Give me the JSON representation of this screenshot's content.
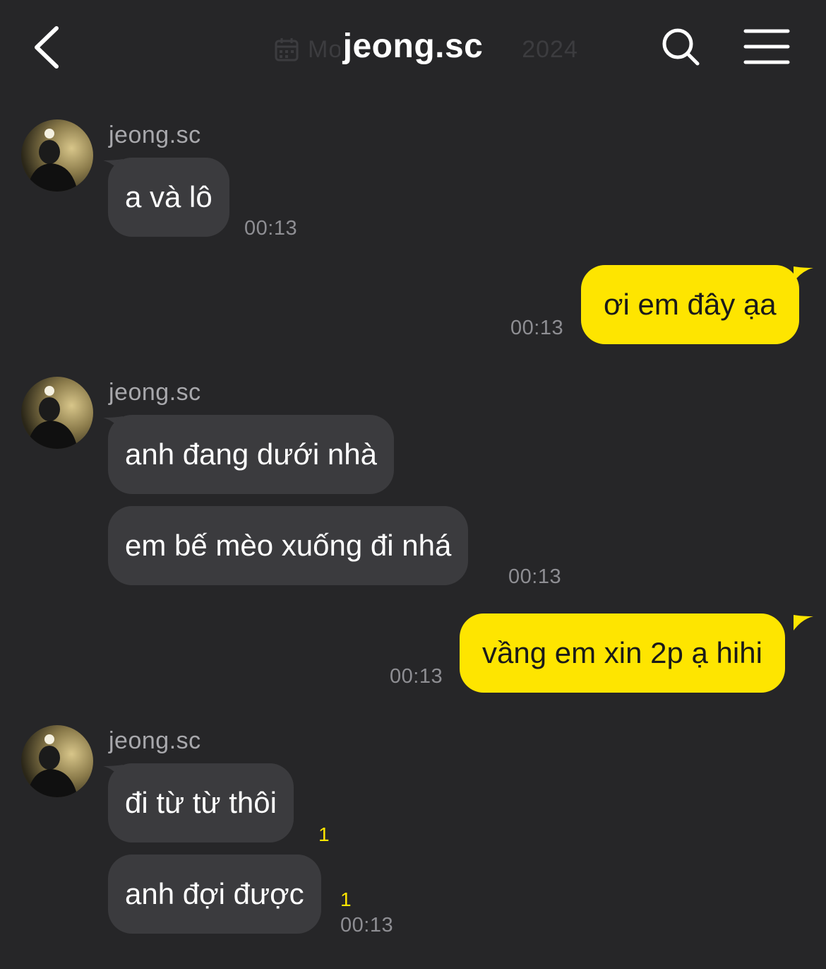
{
  "header": {
    "title": "jeong.sc",
    "date_left": "Mo",
    "date_right": "2024",
    "back_icon": "chevron-left-icon",
    "search_icon": "search-icon",
    "menu_icon": "hamburger-menu-icon",
    "calendar_icon": "calendar-icon"
  },
  "colors": {
    "background": "#262628",
    "incoming_bubble": "#3b3b3e",
    "outgoing_bubble": "#fee500",
    "timestamp": "#8e8e93",
    "sender_name": "#a8a8ac",
    "unread_count": "#fee500"
  },
  "messages": [
    {
      "sender": "jeong.sc",
      "text": "a và lô",
      "time": "00:13"
    },
    {
      "text": "ơi em đây ạa",
      "time": "00:13"
    },
    {
      "sender": "jeong.sc",
      "text": "anh đang dưới nhà"
    },
    {
      "text": "em bế mèo xuống đi nhá",
      "time": "00:13"
    },
    {
      "text": "vầng em xin 2p ạ hihi",
      "time": "00:13"
    },
    {
      "sender": "jeong.sc",
      "text": "đi từ từ thôi",
      "unread": "1"
    },
    {
      "text": "anh đợi được",
      "unread": "1",
      "time": "00:13"
    }
  ]
}
